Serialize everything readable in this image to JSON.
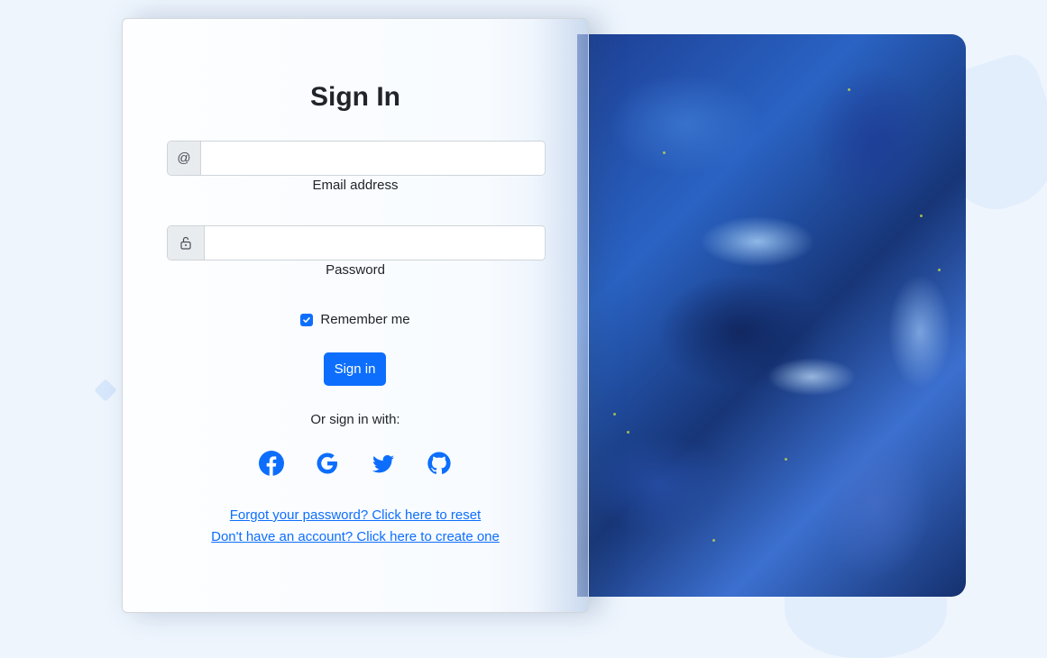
{
  "form": {
    "title": "Sign In",
    "email": {
      "prefix": "@",
      "value": "",
      "label": "Email address"
    },
    "password": {
      "value": "",
      "label": "Password"
    },
    "remember_label": "Remember me",
    "remember_checked": true,
    "submit_label": "Sign in",
    "social_heading": "Or sign in with:",
    "social_icons": [
      "facebook-icon",
      "google-icon",
      "twitter-icon",
      "github-icon"
    ],
    "forgot_link": "Forgot your password? Click here to reset",
    "register_link": "Don't have an account? Click here to create one"
  },
  "colors": {
    "accent": "#0d6efd",
    "background": "#eef5fd"
  }
}
